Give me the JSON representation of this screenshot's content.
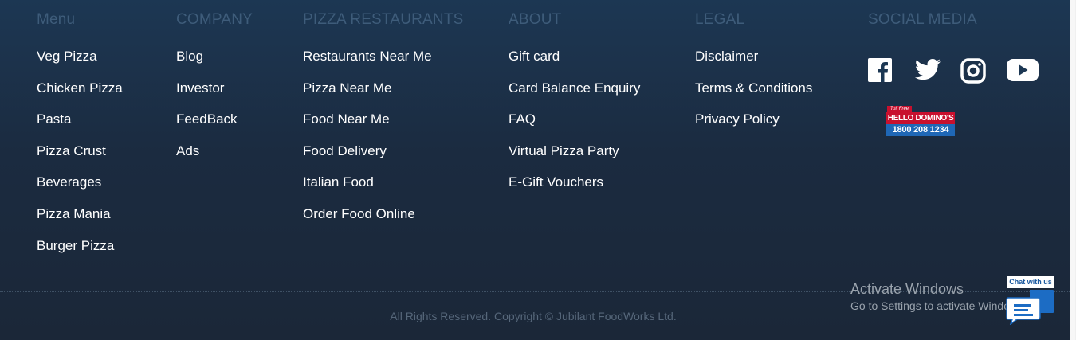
{
  "columns": [
    {
      "heading": "Menu",
      "links": [
        "Veg Pizza",
        "Chicken Pizza",
        "Pasta",
        "Pizza Crust",
        "Beverages",
        "Pizza Mania",
        "Burger Pizza"
      ]
    },
    {
      "heading": "COMPANY",
      "links": [
        "Blog",
        "Investor",
        "FeedBack",
        "Ads"
      ]
    },
    {
      "heading": "PIZZA RESTAURANTS",
      "links": [
        "Restaurants Near Me",
        "Pizza Near Me",
        "Food Near Me",
        "Food Delivery",
        "Italian Food",
        "Order Food Online"
      ]
    },
    {
      "heading": "ABOUT",
      "links": [
        "Gift card",
        "Card Balance Enquiry",
        "FAQ",
        "Virtual Pizza Party",
        "E-Gift Vouchers"
      ]
    },
    {
      "heading": "LEGAL",
      "links": [
        "Disclaimer",
        "Terms & Conditions",
        "Privacy Policy"
      ]
    }
  ],
  "social": {
    "heading": "SOCIAL MEDIA",
    "icons": [
      "facebook-icon",
      "twitter-icon",
      "instagram-icon",
      "youtube-icon"
    ],
    "hello_badge": {
      "toll_free": "Toll Free",
      "brand": "HELLO DOMINO'S",
      "phone": "1800 208 1234"
    }
  },
  "copyright": "All Rights Reserved. Copyright © Jubilant FoodWorks Ltd.",
  "windows_watermark": {
    "title": "Activate Windows",
    "subtitle": "Go to Settings to activate Windows."
  },
  "chat": {
    "label": "Chat with us"
  },
  "colors": {
    "background_top": "#1c3753",
    "background_bottom": "#1b2738",
    "heading": "#3e5c7a",
    "link": "#ffffff",
    "copyright": "#56677a",
    "badge_red": "#c8102e",
    "badge_blue": "#1f67b6"
  }
}
